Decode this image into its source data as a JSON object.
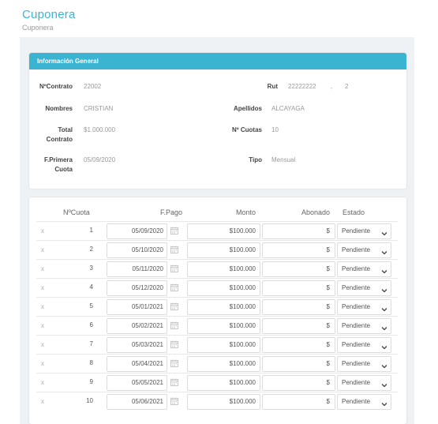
{
  "header": {
    "title": "Cuponera",
    "breadcrumb": "Cuponera"
  },
  "info": {
    "section_title": "Información General",
    "contrato_label": "NºContrato",
    "contrato_value": "22002",
    "rut_label": "Rut",
    "rut_value": "22222222",
    "rut_sep": "-",
    "rut_dv": "2",
    "nombres_label": "Nombres",
    "nombres_value": "CRISTIAN",
    "apellidos_label": "Apellidos",
    "apellidos_value": "ALCAYAGA",
    "total_label_1": "Total",
    "total_label_2": "Contrato",
    "total_value": "$1.000.000",
    "cuotas_label": "Nº Cuotas",
    "cuotas_value": "10",
    "primera_label_1": "F.Primera",
    "primera_label_2": "Cuota",
    "primera_value": "05/09/2020",
    "tipo_label": "Tipo",
    "tipo_value": "Mensual"
  },
  "table": {
    "columns": {
      "cuota": "NºCuota",
      "fpago": "F.Pago",
      "monto": "Monto",
      "abonado": "Abonado",
      "estado": "Estado"
    },
    "rows": [
      {
        "remove": "x",
        "num": "1",
        "fecha": "05/09/2020",
        "monto": "$100.000",
        "abonado": "$",
        "estado": "Pendiente"
      },
      {
        "remove": "x",
        "num": "2",
        "fecha": "05/10/2020",
        "monto": "$100.000",
        "abonado": "$",
        "estado": "Pendiente"
      },
      {
        "remove": "x",
        "num": "3",
        "fecha": "05/11/2020",
        "monto": "$100.000",
        "abonado": "$",
        "estado": "Pendiente"
      },
      {
        "remove": "x",
        "num": "4",
        "fecha": "05/12/2020",
        "monto": "$100.000",
        "abonado": "$",
        "estado": "Pendiente"
      },
      {
        "remove": "x",
        "num": "5",
        "fecha": "05/01/2021",
        "monto": "$100.000",
        "abonado": "$",
        "estado": "Pendiente"
      },
      {
        "remove": "x",
        "num": "6",
        "fecha": "05/02/2021",
        "monto": "$100.000",
        "abonado": "$",
        "estado": "Pendiente"
      },
      {
        "remove": "x",
        "num": "7",
        "fecha": "05/03/2021",
        "monto": "$100.000",
        "abonado": "$",
        "estado": "Pendiente"
      },
      {
        "remove": "x",
        "num": "8",
        "fecha": "05/04/2021",
        "monto": "$100.000",
        "abonado": "$",
        "estado": "Pendiente"
      },
      {
        "remove": "x",
        "num": "9",
        "fecha": "05/05/2021",
        "monto": "$100.000",
        "abonado": "$",
        "estado": "Pendiente"
      },
      {
        "remove": "x",
        "num": "10",
        "fecha": "05/06/2021",
        "monto": "$100.000",
        "abonado": "$",
        "estado": "Pendiente"
      }
    ]
  },
  "colors": {
    "accent": "#3bb4d2",
    "background": "#eef2f4"
  },
  "icons": {
    "date": "calendar-icon",
    "select": "chevron-down-icon",
    "remove": "close-icon"
  }
}
